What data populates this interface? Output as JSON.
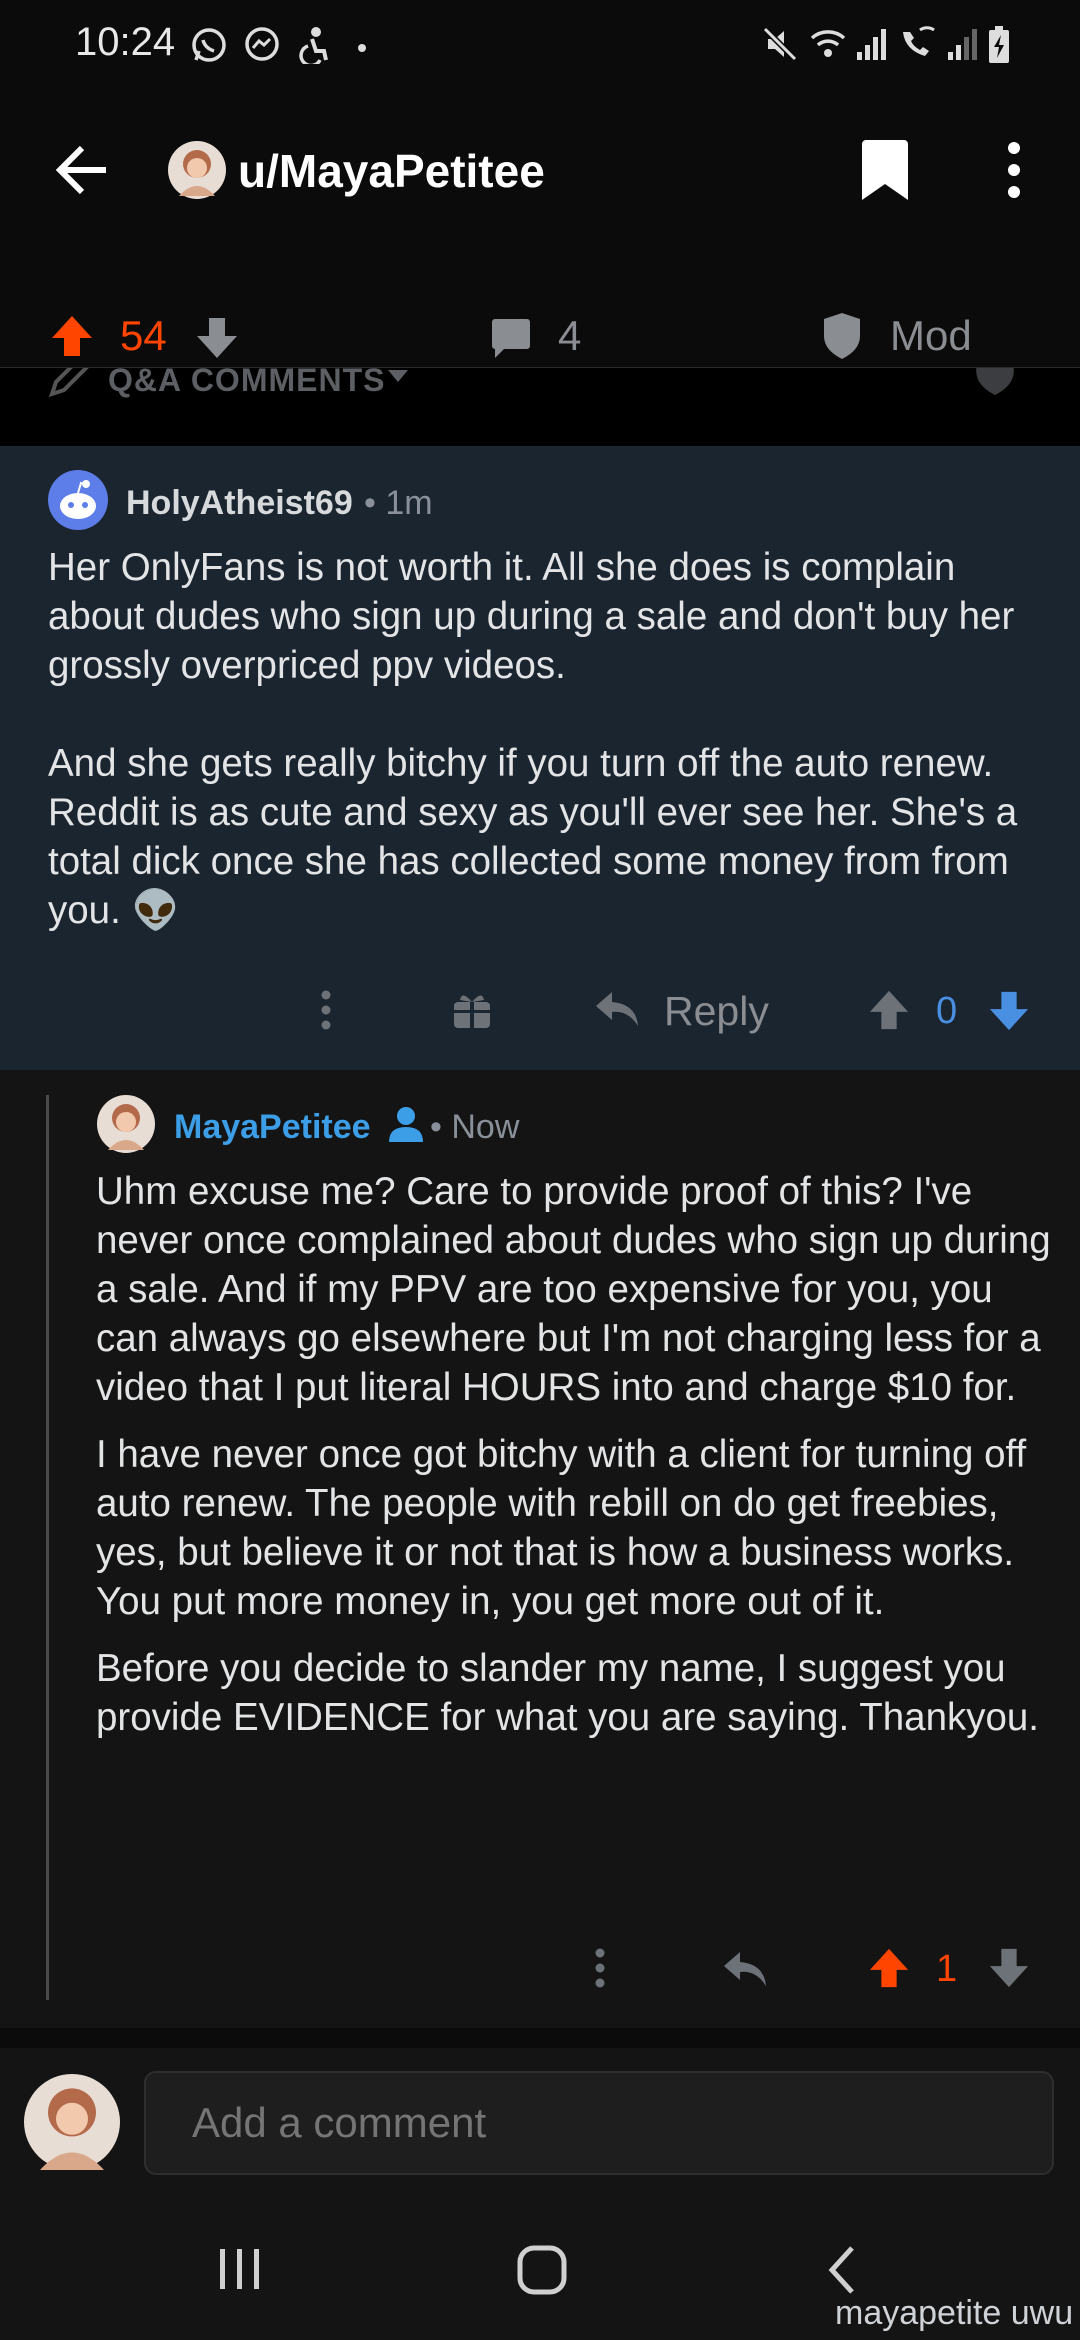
{
  "status_bar": {
    "time": "10:24",
    "icons": [
      "whatsapp-icon",
      "messenger-icon",
      "accessibility-icon",
      "dot-icon",
      "mute-icon",
      "wifi-icon",
      "signal-icon",
      "wifi-calling-icon",
      "signal-icon",
      "battery-charging-icon"
    ]
  },
  "header": {
    "title": "u/MayaPetitee",
    "icons": [
      "back-arrow-icon",
      "bookmark-icon",
      "more-vertical-icon"
    ]
  },
  "action_bar": {
    "score": "54",
    "comments": "4",
    "mod_label": "Mod"
  },
  "peek": {
    "label": "Q&A COMMENTS"
  },
  "comments": [
    {
      "author": "HolyAtheist69",
      "age": "1m",
      "paragraphs": [
        "Her OnlyFans is not worth it. All she does is complain about dudes who sign up during a sale and don't buy her grossly overpriced ppv videos.",
        "And she gets really bitchy if you turn off the auto renew.  Reddit is as cute and sexy as you'll ever see her.  She's a total dick once she has collected some money from from you. 👽"
      ],
      "reply_label": "Reply",
      "score": "0"
    },
    {
      "author": "MayaPetitee",
      "age": "Now",
      "paragraphs": [
        "Uhm excuse me? Care to provide proof of this? I've never once complained about dudes who sign up during a sale. And if my PPV are too expensive for you, you can always go elsewhere but I'm not charging less for a video that I put literal HOURS into and charge $10 for.",
        "I have never once got bitchy with a client for turning off auto renew. The people with rebill on do get freebies, yes, but believe it or not that is how a business works. You put more money in, you get more out of it.",
        "Before you decide to slander my name, I suggest you provide EVIDENCE for what you are saying. Thankyou."
      ],
      "score": "1"
    }
  ],
  "composer": {
    "placeholder": "Add a comment"
  },
  "watermark": "mayapetite uwu",
  "colors": {
    "upvote": "#ff4500",
    "downvote_active": "#4a90e2",
    "op_name": "#3d9ee8",
    "comment1_bg": "#1b2530",
    "background": "#0b0b0b"
  }
}
